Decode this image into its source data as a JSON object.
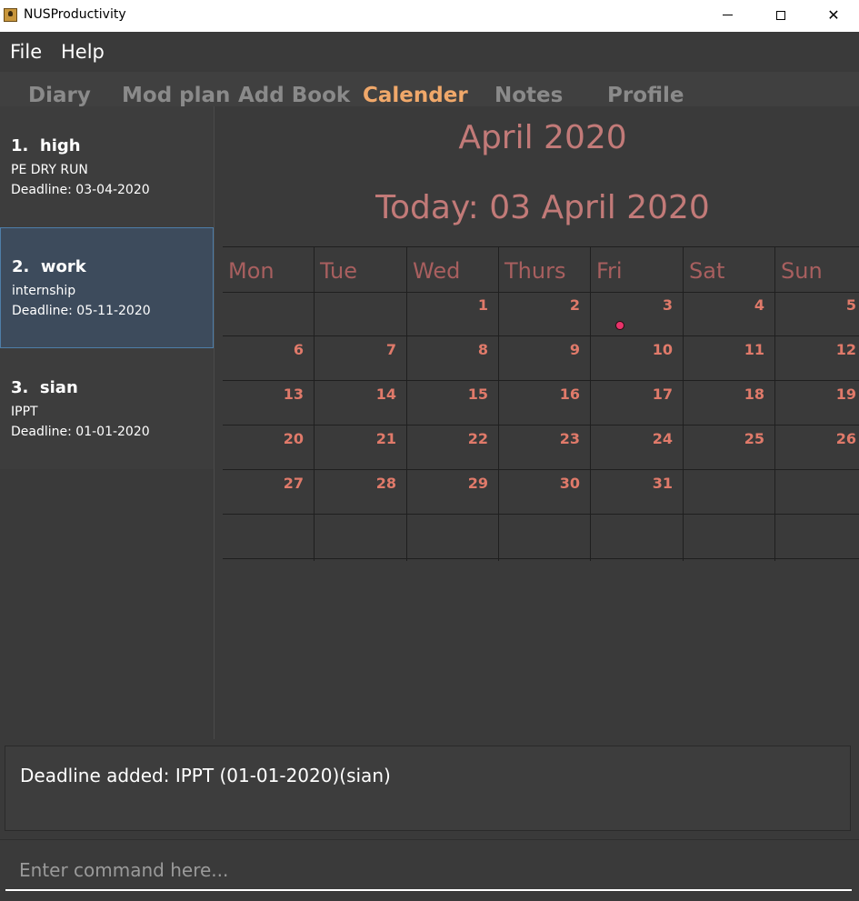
{
  "window": {
    "title": "NUSProductivity",
    "icon": "app-icon",
    "controls": {
      "minimize": "minimize-icon",
      "maximize": "maximize-icon",
      "close": "✕"
    }
  },
  "menu": {
    "items": [
      "File",
      "Help"
    ]
  },
  "tabs": {
    "items": [
      "Diary",
      "Mod plan",
      "Add Book",
      "Calender",
      "Notes",
      "Profile"
    ],
    "active": "Calender"
  },
  "deadlines": [
    {
      "index": "1.",
      "title": "high",
      "description": "PE DRY RUN",
      "deadline": "Deadline: 03-04-2020"
    },
    {
      "index": "2.",
      "title": "work",
      "description": "internship",
      "deadline": "Deadline: 05-11-2020"
    },
    {
      "index": "3.",
      "title": "sian",
      "description": "IPPT",
      "deadline": "Deadline: 01-01-2020"
    }
  ],
  "calendar": {
    "month_title": "April 2020",
    "today_title": "Today: 03 April 2020",
    "day_names": [
      "Mon",
      "Tue",
      "Wed",
      "Thurs",
      "Fri",
      "Sat",
      "Sun"
    ],
    "weeks": [
      [
        "",
        "",
        "1",
        "2",
        "3",
        "4",
        "5"
      ],
      [
        "6",
        "7",
        "8",
        "9",
        "10",
        "11",
        "12"
      ],
      [
        "13",
        "14",
        "15",
        "16",
        "17",
        "18",
        "19"
      ],
      [
        "20",
        "21",
        "22",
        "23",
        "24",
        "25",
        "26"
      ],
      [
        "27",
        "28",
        "29",
        "30",
        "31",
        "",
        ""
      ],
      [
        "",
        "",
        "",
        "",
        "",
        "",
        ""
      ]
    ],
    "event_days": [
      "3"
    ],
    "colors": {
      "title": "#c27a78",
      "day_name": "#a85f5f",
      "day_number": "#e07a6a",
      "event_dot": "#e8336a"
    }
  },
  "result": {
    "text": "Deadline added: IPPT (01-01-2020)(sian)"
  },
  "command": {
    "placeholder": "Enter command here...",
    "value": ""
  },
  "colors": {
    "background": "#3a3a3a",
    "active_tab": "#f0a86a",
    "selected_card": "#3d4b5c"
  }
}
